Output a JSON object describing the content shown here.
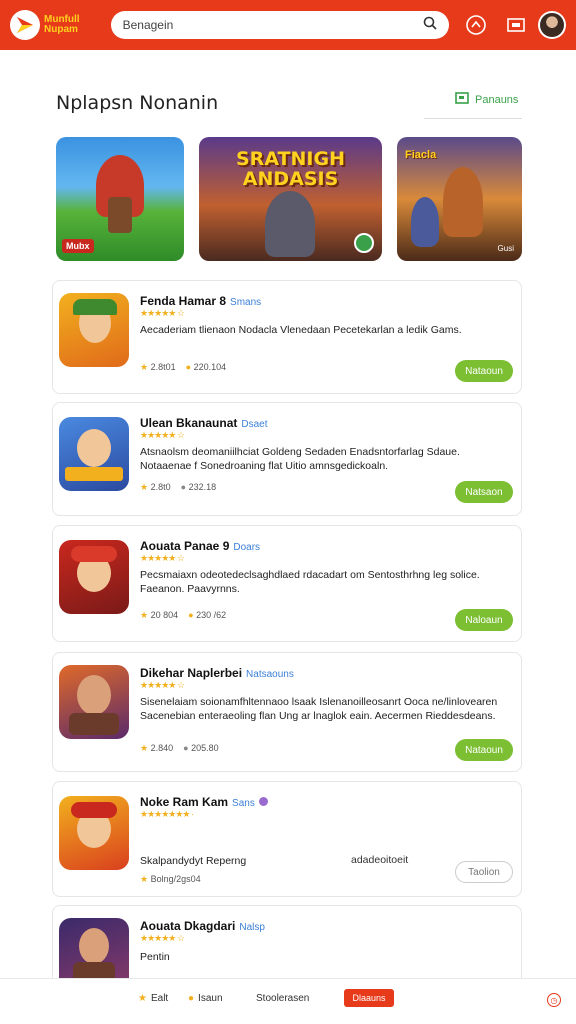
{
  "header": {
    "logo_text": "Munfull Nupam",
    "search_value": "Benagein",
    "icons": [
      "search-icon",
      "controller-icon",
      "news-icon"
    ],
    "accent_color": "#e63a1b"
  },
  "section": {
    "title": "Nplapsn Nonanin",
    "link_label": "Panauns"
  },
  "banners": [
    {
      "title": "",
      "tag": "Mubx"
    },
    {
      "title": "SRATNIGH ANDASIS",
      "tag": ""
    },
    {
      "title": "Fiacla",
      "tag": "Gusi"
    }
  ],
  "apps": [
    {
      "name": "Fenda Hamar 8",
      "tag": "Smans",
      "desc": "Aecaderiam tlienaon Nodacla Vlenedaan Pecetekarlan a ledik Gams.",
      "rating": "2.8t01",
      "downloads": "220.104",
      "button": "Nataoun"
    },
    {
      "name": "Ulean Bkanaunat",
      "tag": "Dsaet",
      "desc": "Atsnaolsm deomaniilhciat Goldeng Sedaden Enadsntorfarlag Sdaue. Notaaenae f Sonedroaning flat Uitio amnsgedickoaln.",
      "rating": "2.8t0",
      "downloads": "232.18",
      "button": "Natsaon"
    },
    {
      "name": "Aouata Panae 9",
      "tag": "Doars",
      "desc": "Pecsmaiaxn odeotedeclsaghdlaed rdacadart om Sentosthrhng leg solice. Faeanon. Paavyrnns.",
      "rating": "20 804",
      "downloads": "230 /62",
      "button": "Naloaun"
    },
    {
      "name": "Dikehar Naplerbei",
      "tag": "Natsaouns",
      "desc": "Sisenelaiam soionamfhltennaoo lsaak Islenanoilleosanrt Ooca ne/linlovearen Sacenebian enteraeoling flan Ung ar lnaglok eain. Aecermen Rieddesdeans.",
      "rating": "2.840",
      "downloads": "205.80",
      "button": "Nataoun"
    },
    {
      "name": "Noke Ram Kam",
      "tag": "Sans",
      "desc": "Skalpandydyt Reperng",
      "desc_right": "adadeoitoeit",
      "rating": "Bolng/2gs04",
      "downloads": "",
      "button": "Taolion"
    },
    {
      "name": "Aouata Dkagdari",
      "tag": "Nalsp",
      "desc": "Pentin",
      "rating": "",
      "downloads": "",
      "button": ""
    }
  ],
  "bottom_bar": {
    "items": [
      "Ealt",
      "Isaun",
      "Stoolerasen"
    ],
    "active_label": "Dlaauns"
  }
}
